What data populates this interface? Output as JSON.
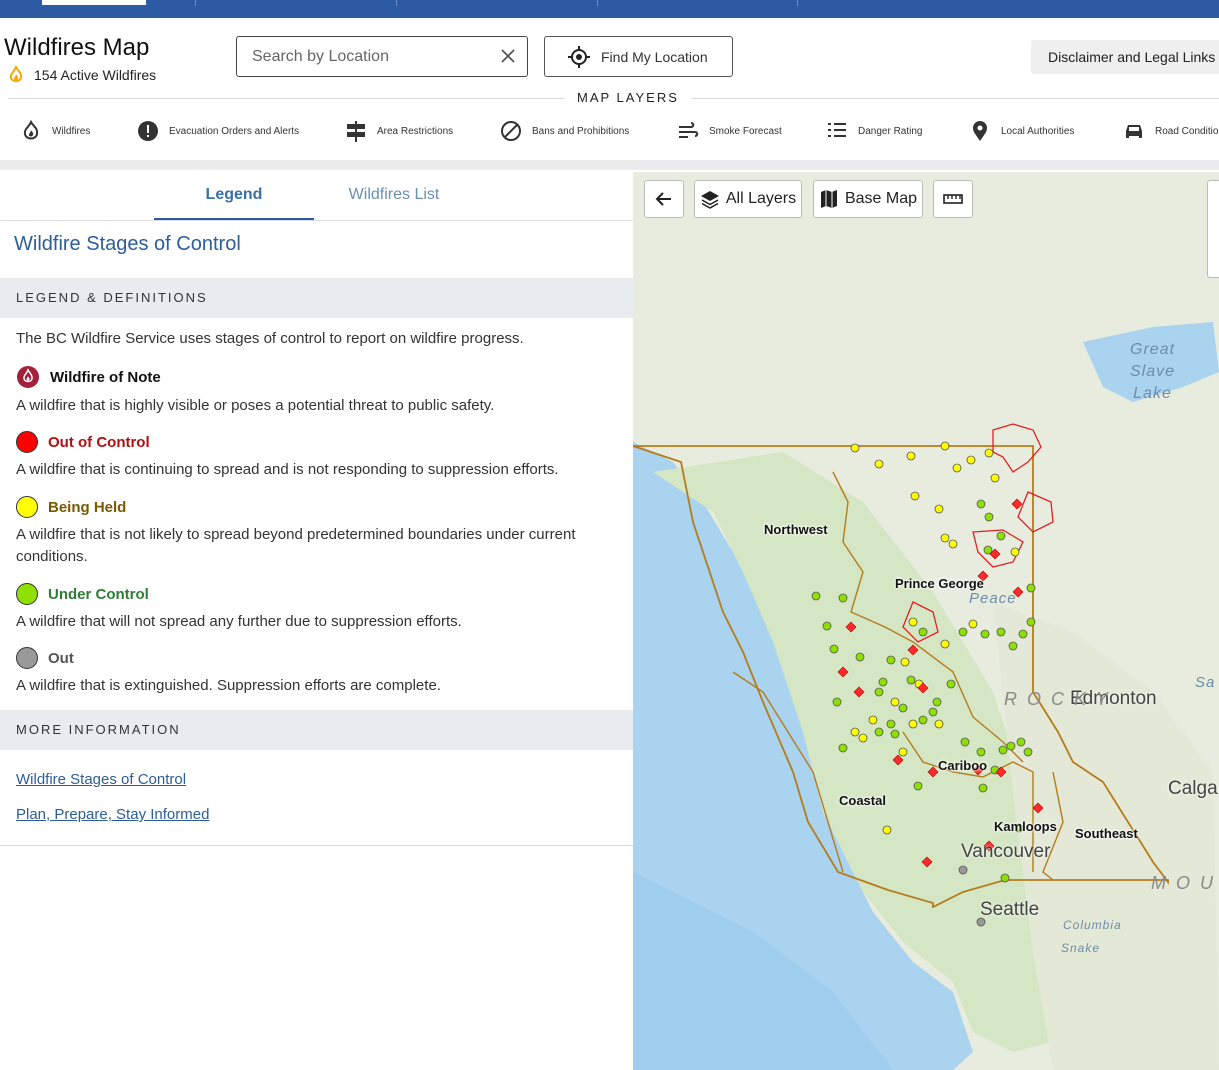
{
  "header": {
    "title": "Wildfires Map",
    "active_count": "154 Active Wildfires",
    "search_placeholder": "Search by Location",
    "find_location": "Find My Location",
    "disclaimer": "Disclaimer and Legal Links",
    "map_layers_title": "MAP LAYERS"
  },
  "layers": [
    {
      "label": "Wildfires",
      "icon": "flame-icon"
    },
    {
      "label": "Evacuation Orders and Alerts",
      "icon": "alert-icon"
    },
    {
      "label": "Area Restrictions",
      "icon": "signpost-icon"
    },
    {
      "label": "Bans and Prohibitions",
      "icon": "ban-icon"
    },
    {
      "label": "Smoke Forecast",
      "icon": "wind-icon"
    },
    {
      "label": "Danger Rating",
      "icon": "list-icon"
    },
    {
      "label": "Local Authorities",
      "icon": "pin-icon"
    },
    {
      "label": "Road Conditio",
      "icon": "car-icon"
    }
  ],
  "tabs": {
    "legend": "Legend",
    "list": "Wildfires List"
  },
  "legend": {
    "heading": "Wildfire Stages of Control",
    "section1": "LEGEND & DEFINITIONS",
    "intro": "The BC Wildfire Service uses stages of control to report on wildfire progress.",
    "stages": [
      {
        "name": "Wildfire of Note",
        "desc": "A wildfire that is highly visible or poses a potential threat to public safety.",
        "color": "#a31f3a"
      },
      {
        "name": "Out of Control",
        "desc": "A wildfire that is continuing to spread and is not responding to suppression efforts.",
        "color": "#ff0000"
      },
      {
        "name": "Being Held",
        "desc": "A wildfire that is not likely to spread beyond predetermined boundaries under current conditions.",
        "color": "#ffff00"
      },
      {
        "name": "Under Control",
        "desc": "A wildfire that will not spread any further due to suppression efforts.",
        "color": "#8ee000"
      },
      {
        "name": "Out",
        "desc": "A wildfire that is extinguished. Suppression efforts are complete.",
        "color": "#999999"
      }
    ],
    "section2": "MORE INFORMATION",
    "links": [
      "Wildfire Stages of Control",
      "Plan, Prepare, Stay Informed"
    ]
  },
  "map": {
    "buttons": {
      "all_layers": "All Layers",
      "base_map": "Base Map"
    },
    "regions": [
      "Northwest",
      "Prince George",
      "Cariboo",
      "Coastal",
      "Kamloops",
      "Southeast"
    ],
    "cities": [
      "Edmonton",
      "Calga",
      "Vancouver",
      "Seattle"
    ],
    "water": [
      "Great",
      "Slave",
      "Lake"
    ],
    "terrain": [
      "Peace",
      "ROCKY",
      "MOUN",
      "Columbia",
      "Snake",
      "Sa"
    ]
  }
}
